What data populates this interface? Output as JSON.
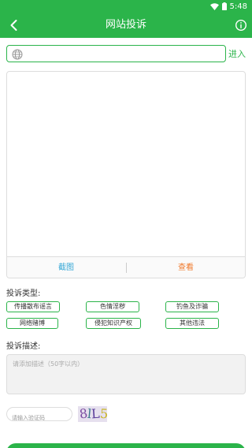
{
  "status_bar": {
    "time": "5:48"
  },
  "header": {
    "title": "网站投诉",
    "back_icon": "back-arrow-icon",
    "info_icon": "info-circle-icon"
  },
  "url_bar": {
    "value": "",
    "placeholder": "",
    "go_label": "进入",
    "icon": "globe-icon"
  },
  "screenshot_panel": {
    "capture_label": "截图",
    "view_label": "查看"
  },
  "complaint_types": {
    "label": "投诉类型:",
    "options": [
      "传播散布谣言",
      "色情淫秽",
      "钓鱼及诈骗",
      "网络赌博",
      "侵犯知识产权",
      "其他违法"
    ]
  },
  "description": {
    "label": "投诉描述:",
    "placeholder": "请添加描述（50字以内）"
  },
  "captcha": {
    "placeholder": "请输入验证码",
    "chars": [
      "8",
      "l",
      "L",
      "5"
    ]
  },
  "colors": {
    "primary": "#2bb44a",
    "capture": "#35a7d6",
    "view": "#f07a2c"
  }
}
